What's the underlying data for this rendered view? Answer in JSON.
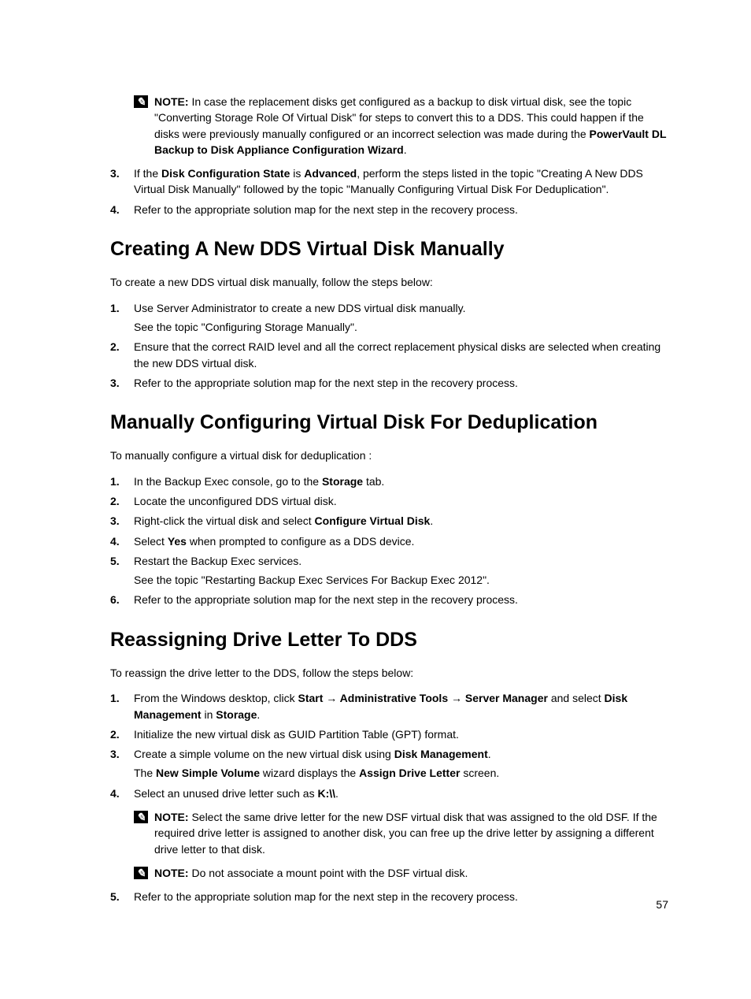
{
  "topNote": {
    "label": "NOTE:",
    "pre": " In case the replacement disks get configured as a backup to disk virtual disk, see the topic \"Converting Storage Role Of Virtual Disk\" for steps to convert this to a DDS. This could happen if the disks were previously manually configured or an incorrect selection was made during the ",
    "bold": "PowerVault DL Backup to Disk Appliance Configuration Wizard",
    "post": "."
  },
  "topSteps": [
    {
      "num": "3.",
      "parts": [
        "If the ",
        "Disk Configuration State",
        " is ",
        "Advanced",
        ", perform the steps listed in the topic \"Creating A New DDS Virtual Disk Manually\" followed by the topic \"Manually Configuring Virtual Disk For Deduplication\"."
      ]
    },
    {
      "num": "4.",
      "parts": [
        "Refer to the appropriate solution map for the next step in the recovery process."
      ]
    }
  ],
  "sec1": {
    "title": "Creating A New DDS Virtual Disk Manually",
    "intro": "To create a new DDS virtual disk manually, follow the steps below:",
    "steps": [
      {
        "num": "1.",
        "main": "Use Server Administrator to create a new DDS virtual disk manually.",
        "sub": "See the topic \"Configuring Storage Manually\"."
      },
      {
        "num": "2.",
        "main": "Ensure that the correct RAID level and all the correct replacement physical disks are selected when creating the new DDS virtual disk."
      },
      {
        "num": "3.",
        "main": "Refer to the appropriate solution map for the next step in the recovery process."
      }
    ]
  },
  "sec2": {
    "title": "Manually Configuring Virtual Disk For Deduplication",
    "intro": "To manually configure a virtual disk for deduplication :",
    "steps": [
      {
        "num": "1.",
        "parts": [
          "In the Backup Exec console, go to the ",
          "Storage",
          " tab."
        ]
      },
      {
        "num": "2.",
        "parts": [
          "Locate the unconfigured DDS virtual disk."
        ]
      },
      {
        "num": "3.",
        "parts": [
          "Right-click the virtual disk and select ",
          "Configure Virtual Disk",
          "."
        ]
      },
      {
        "num": "4.",
        "parts": [
          "Select ",
          "Yes",
          " when prompted to configure as a DDS device."
        ]
      },
      {
        "num": "5.",
        "parts": [
          "Restart the Backup Exec services."
        ],
        "sub": "See the topic \"Restarting Backup Exec Services For Backup Exec 2012\"."
      },
      {
        "num": "6.",
        "parts": [
          "Refer to the appropriate solution map for the next step in the recovery process."
        ]
      }
    ]
  },
  "sec3": {
    "title": "Reassigning Drive Letter To DDS",
    "intro": "To reassign the drive letter to the DDS, follow the steps below:",
    "step1": {
      "num": "1.",
      "parts": [
        "From the Windows desktop, click ",
        "Start → Administrative Tools → Server Manager ",
        " and select ",
        "Disk Management",
        " in ",
        "Storage",
        "."
      ]
    },
    "step2": {
      "num": "2.",
      "text": "Initialize the new virtual disk as GUID Partition Table (GPT) format."
    },
    "step3": {
      "num": "3.",
      "parts": [
        "Create a simple volume on the new virtual disk using ",
        "Disk Management",
        "."
      ],
      "subParts": [
        "The ",
        "New Simple Volume",
        " wizard displays the ",
        "Assign Drive Letter",
        " screen."
      ]
    },
    "step4": {
      "num": "4.",
      "parts": [
        "Select an unused drive letter such as ",
        "K:\\\\",
        "."
      ]
    },
    "note1": {
      "label": "NOTE:",
      "text": " Select the same drive letter for the new DSF virtual disk that was assigned to the old DSF. If the required drive letter is assigned to another disk, you can free up the drive letter by assigning a different drive letter to that disk."
    },
    "note2": {
      "label": "NOTE:",
      "text": " Do not associate a mount point with the DSF virtual disk."
    },
    "step5": {
      "num": "5.",
      "text": "Refer to the appropriate solution map for the next step in the recovery process."
    }
  },
  "pageNumber": "57",
  "noteGlyph": "✎"
}
